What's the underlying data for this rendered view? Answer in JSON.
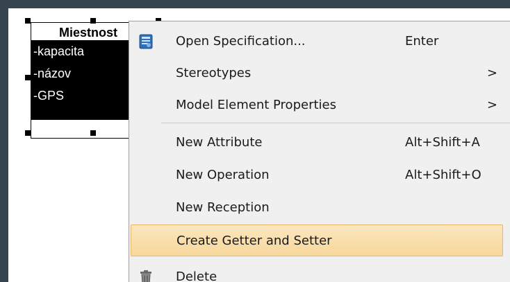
{
  "diagram": {
    "class_name": "Miestnost",
    "attributes": [
      "-kapacita",
      "-názov",
      "-GPS"
    ]
  },
  "context_menu": {
    "items": [
      {
        "label": "Open Specification...",
        "shortcut": "Enter",
        "arrow": "",
        "icon": "specification-icon"
      },
      {
        "label": "Stereotypes",
        "shortcut": "",
        "arrow": ">"
      },
      {
        "label": "Model Element Properties",
        "shortcut": "",
        "arrow": ">"
      },
      {
        "label": "New Attribute",
        "shortcut": "Alt+Shift+A",
        "arrow": ""
      },
      {
        "label": "New Operation",
        "shortcut": "Alt+Shift+O",
        "arrow": ""
      },
      {
        "label": "New Reception",
        "shortcut": "",
        "arrow": ""
      },
      {
        "label": "Create Getter and Setter",
        "shortcut": "",
        "arrow": "",
        "highlighted": true
      },
      {
        "label": "Delete",
        "shortcut": "",
        "arrow": "",
        "icon": "trash-icon"
      }
    ]
  },
  "colors": {
    "background": "#36444f",
    "highlight": "#f7d79c",
    "highlight_border": "#e8b766"
  }
}
